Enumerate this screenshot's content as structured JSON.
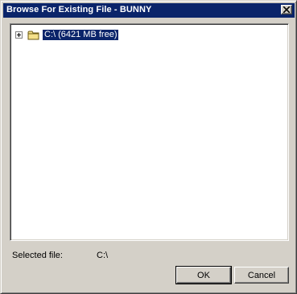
{
  "window": {
    "title": "Browse For Existing File - BUNNY",
    "close_icon": "close-icon"
  },
  "tree": {
    "nodes": [
      {
        "label": "C:\\ (6421 MB free)",
        "icon": "folder-icon",
        "expanded": false,
        "selected": true
      }
    ]
  },
  "selection": {
    "label": "Selected file:",
    "value": "C:\\"
  },
  "buttons": {
    "ok_label": "OK",
    "cancel_label": "Cancel"
  },
  "colors": {
    "titlebar": "#0a246a",
    "face": "#d4d0c8",
    "selection": "#0a246a"
  }
}
